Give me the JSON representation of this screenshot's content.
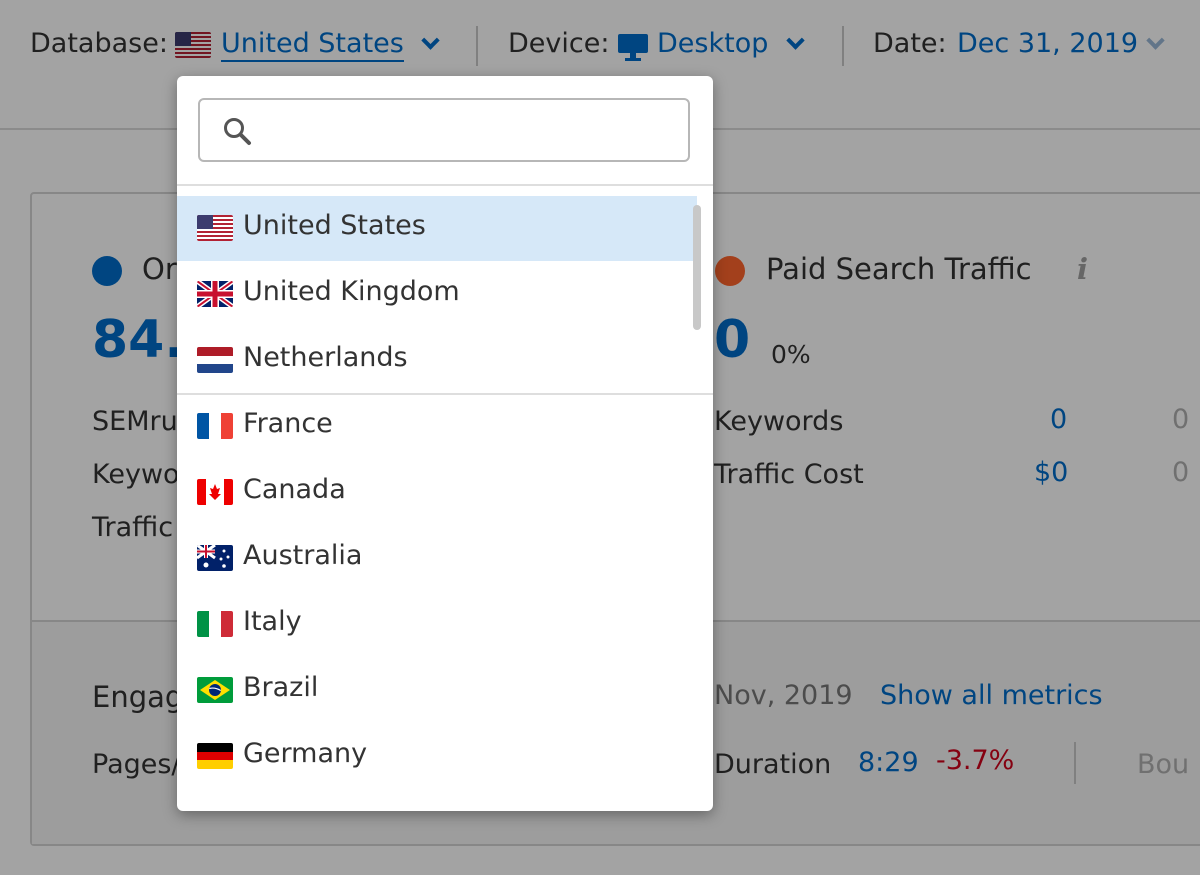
{
  "topbar": {
    "database_label": "Database:",
    "database_value": "United States",
    "device_label": "Device:",
    "device_value": "Desktop",
    "date_label": "Date:",
    "date_value": "Dec 31, 2019"
  },
  "organic": {
    "title_fragment": "Or",
    "value_fragment": "84.",
    "rows": [
      "SEMru",
      "Keywo",
      "Traffic"
    ]
  },
  "paid": {
    "title": "Paid Search Traffic",
    "info": "i",
    "value": "0",
    "change": "0%",
    "rows": [
      {
        "label": "Keywords",
        "value": "0",
        "trail": "0"
      },
      {
        "label": "Traffic Cost",
        "value": "$0",
        "trail": "0"
      }
    ]
  },
  "engagement": {
    "title_fragment": "Engag",
    "period": "Nov, 2019",
    "show_all": "Show all metrics",
    "pages_fragment": "Pages/",
    "duration_fragment": "Duration",
    "duration_value": "8:29",
    "duration_change": "-3.7%",
    "bounce_fragment": "Bou"
  },
  "dropdown": {
    "search_placeholder": "",
    "items": [
      {
        "label": "United States",
        "flag": "us-flag",
        "selected": true
      },
      {
        "label": "United Kingdom",
        "flag": "uk-flag"
      },
      {
        "label": "Netherlands",
        "flag": "nl-flag"
      },
      {
        "label": "France",
        "flag": "fr-flag"
      },
      {
        "label": "Canada",
        "flag": "ca-flag"
      },
      {
        "label": "Australia",
        "flag": "au-flag"
      },
      {
        "label": "Italy",
        "flag": "it-flag"
      },
      {
        "label": "Brazil",
        "flag": "br-flag"
      },
      {
        "label": "Germany",
        "flag": "de-flag"
      }
    ]
  },
  "colors": {
    "accent": "#006dca",
    "organic_dot": "#006dca",
    "paid_dot": "#ff642d",
    "negative": "#d0021b",
    "selected_row": "#d6e8f8"
  }
}
